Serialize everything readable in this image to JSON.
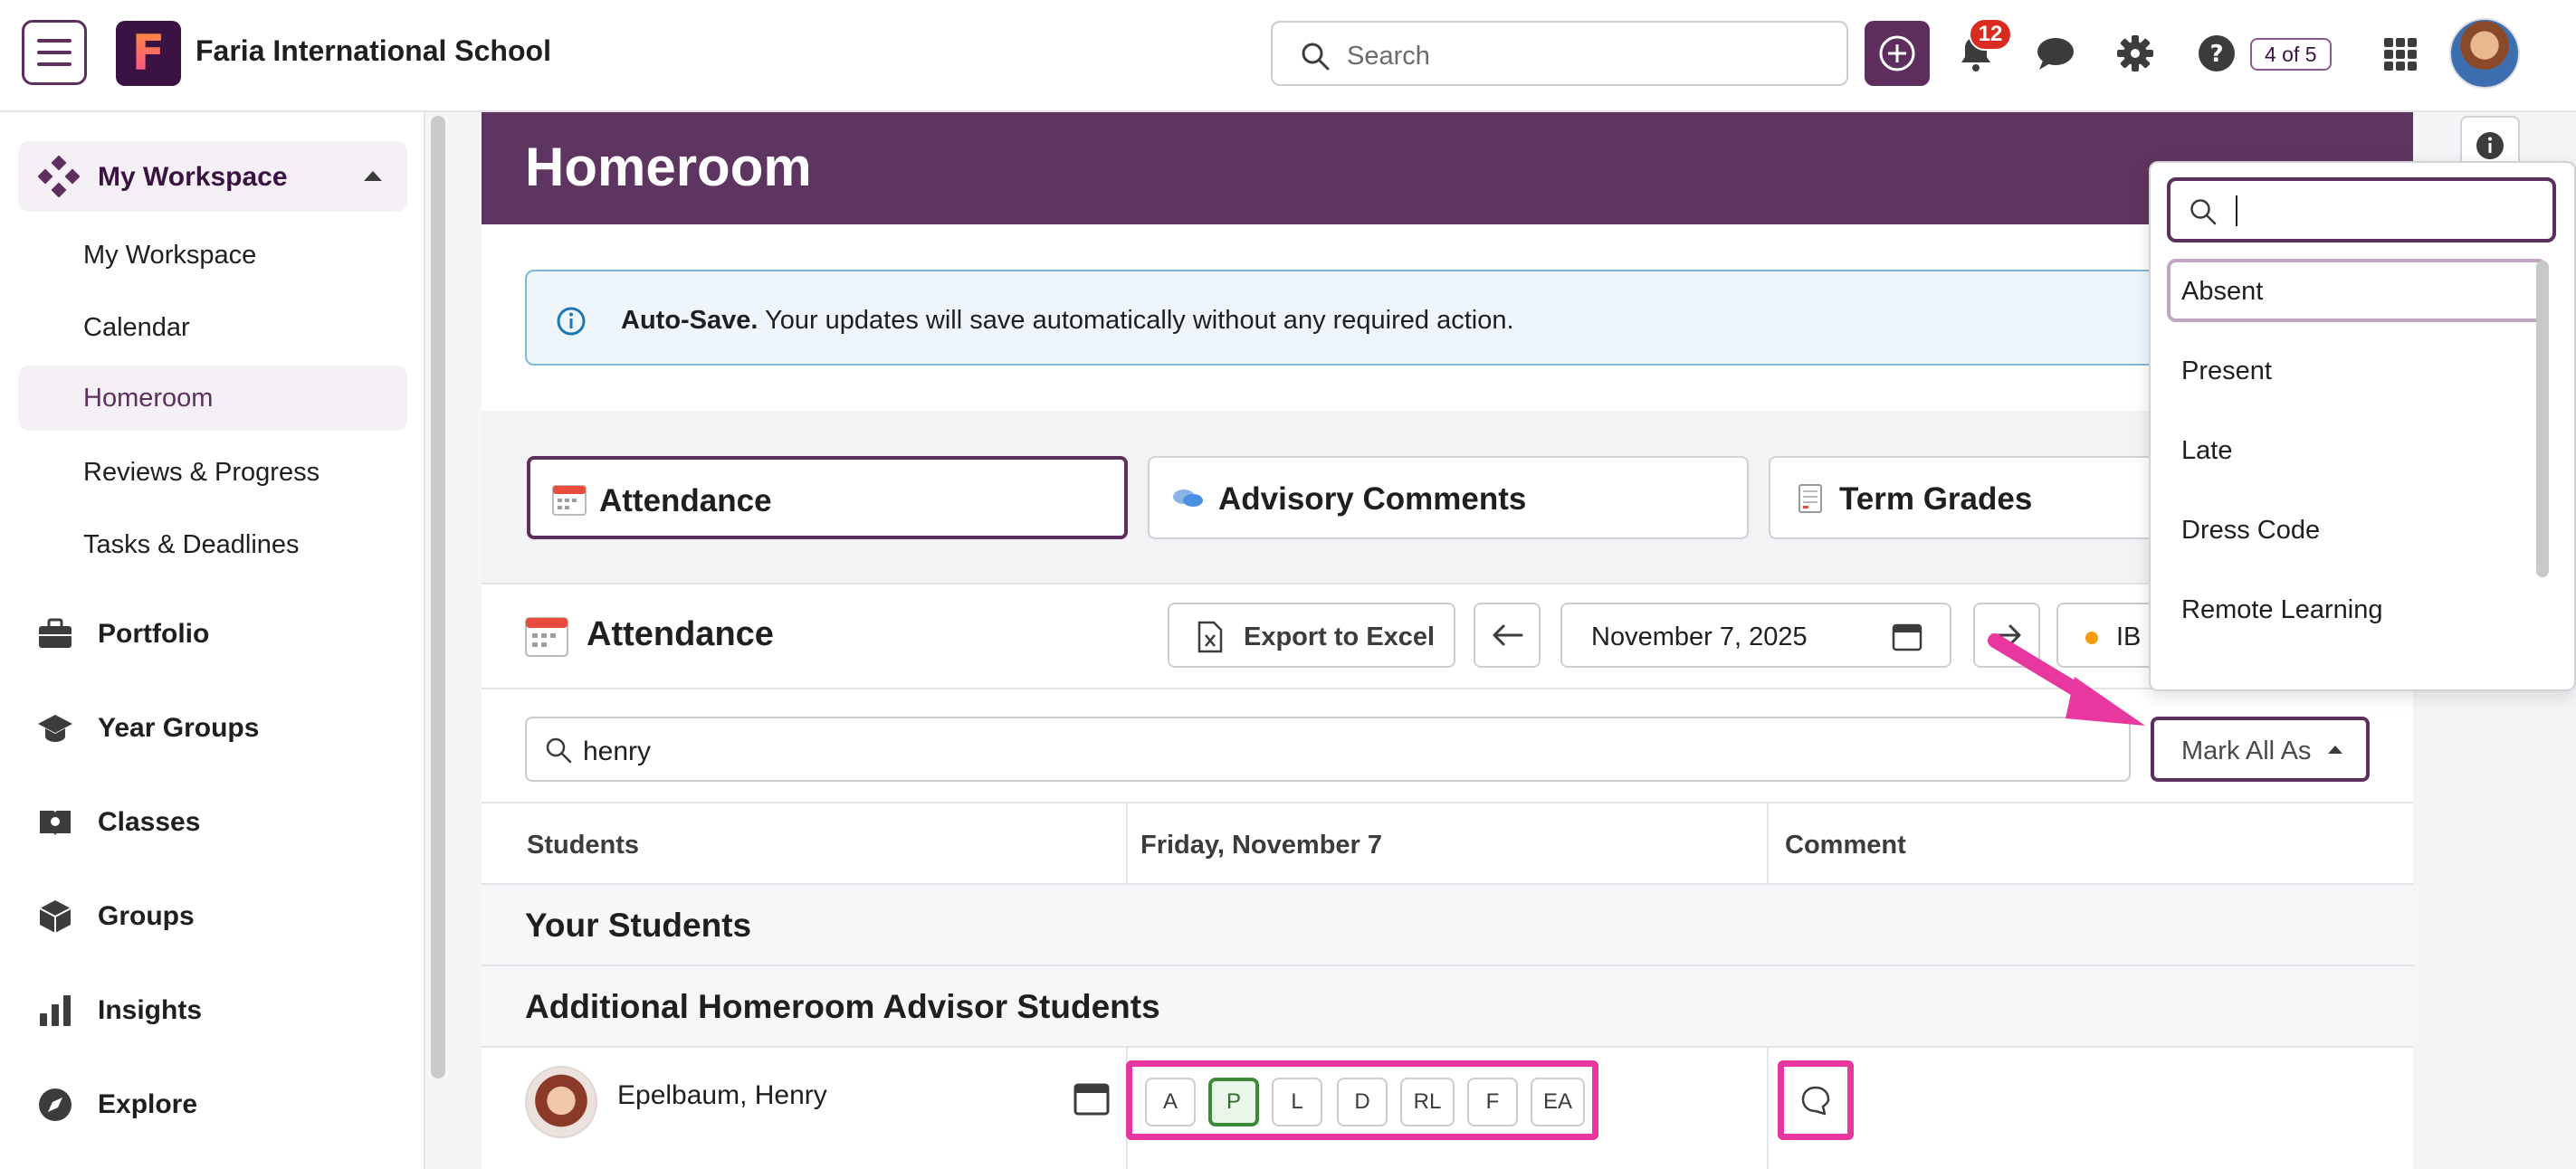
{
  "app": {
    "school_name": "Faria International School",
    "search_placeholder": "Search",
    "notification_count": "12",
    "page_indicator": "4 of 5"
  },
  "sidebar": {
    "section": "My Workspace",
    "sub_items": [
      {
        "label": "My Workspace"
      },
      {
        "label": "Calendar"
      },
      {
        "label": "Homeroom"
      },
      {
        "label": "Reviews & Progress"
      },
      {
        "label": "Tasks & Deadlines"
      }
    ],
    "main_items": [
      {
        "label": "Portfolio",
        "icon": "briefcase-icon"
      },
      {
        "label": "Year Groups",
        "icon": "graduation-cap-icon"
      },
      {
        "label": "Classes",
        "icon": "book-icon"
      },
      {
        "label": "Groups",
        "icon": "cube-icon"
      },
      {
        "label": "Insights",
        "icon": "bar-chart-icon"
      },
      {
        "label": "Explore",
        "icon": "compass-icon"
      }
    ]
  },
  "page": {
    "title": "Homeroom",
    "autosave_bold": "Auto-Save.",
    "autosave_text": " Your updates will save automatically without any required action.",
    "tabs": [
      {
        "label": "Attendance"
      },
      {
        "label": "Advisory Comments"
      },
      {
        "label": "Term Grades"
      }
    ]
  },
  "attendance": {
    "title": "Attendance",
    "export_label": "Export to Excel",
    "date": "November 7, 2025",
    "term_label": "IB DP",
    "search_value": "henry",
    "mark_all_label": "Mark All As",
    "columns": {
      "students": "Students",
      "day": "Friday, November 7",
      "comment": "Comment"
    },
    "groups": {
      "your_students": "Your Students",
      "additional": "Additional Homeroom Advisor Students"
    },
    "student": {
      "name": "Epelbaum, Henry",
      "codes": [
        "A",
        "P",
        "L",
        "D",
        "RL",
        "F",
        "EA"
      ],
      "selected_code": "P"
    }
  },
  "dropdown": {
    "options": [
      "Absent",
      "Present",
      "Late",
      "Dress Code",
      "Remote Learning"
    ]
  },
  "colors": {
    "brand": "#5e2e5f",
    "header_band": "#5e3561",
    "annotation": "#e8379f",
    "selected_code": "#3a8a3a"
  }
}
